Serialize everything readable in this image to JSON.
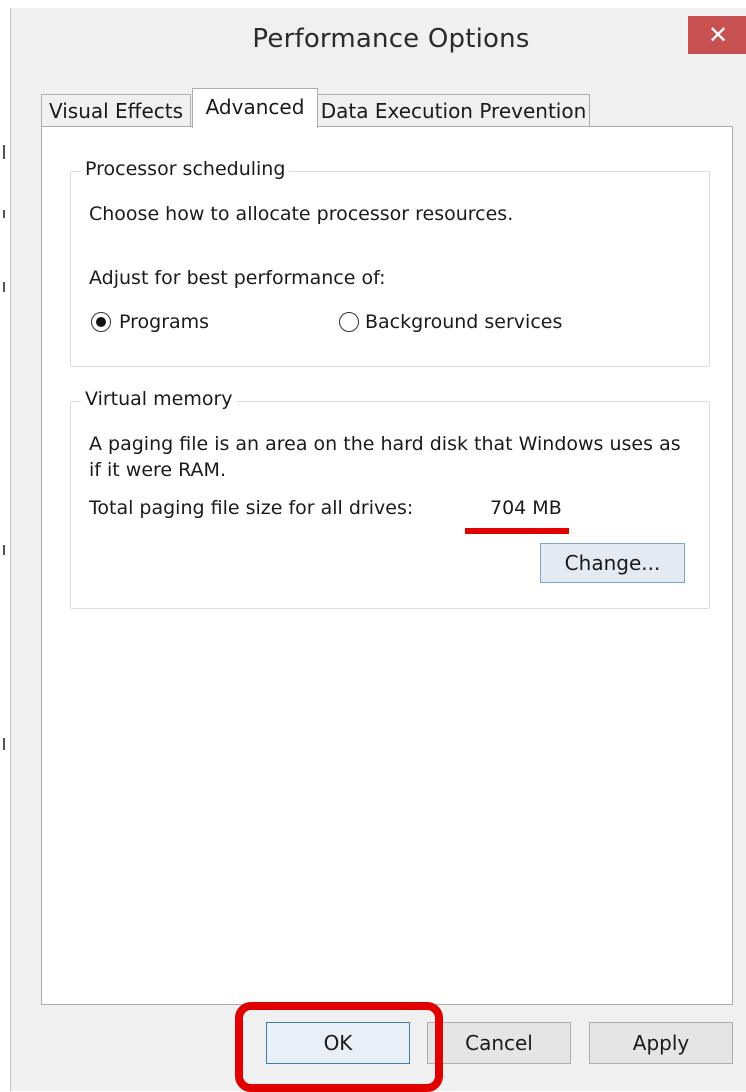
{
  "window": {
    "title": "Performance Options",
    "close_glyph": "✕"
  },
  "tabs": [
    {
      "label": "Visual Effects",
      "active": false
    },
    {
      "label": "Advanced",
      "active": true
    },
    {
      "label": "Data Execution Prevention",
      "active": false
    }
  ],
  "processor_scheduling": {
    "legend": "Processor scheduling",
    "description": "Choose how to allocate processor resources.",
    "adjust_label": "Adjust for best performance of:",
    "options": [
      {
        "label": "Programs",
        "selected": true
      },
      {
        "label": "Background services",
        "selected": false
      }
    ]
  },
  "virtual_memory": {
    "legend": "Virtual memory",
    "description_line1": "A paging file is an area on the hard disk that Windows uses as",
    "description_line2": "if it were RAM.",
    "total_label": "Total paging file size for all drives:",
    "total_value": "704 MB",
    "change_button": "Change..."
  },
  "footer": {
    "ok": "OK",
    "cancel": "Cancel",
    "apply": "Apply"
  },
  "colors": {
    "annotation_red": "#e00000",
    "close_button": "#c75050",
    "default_button_border": "#3c7fb1"
  }
}
